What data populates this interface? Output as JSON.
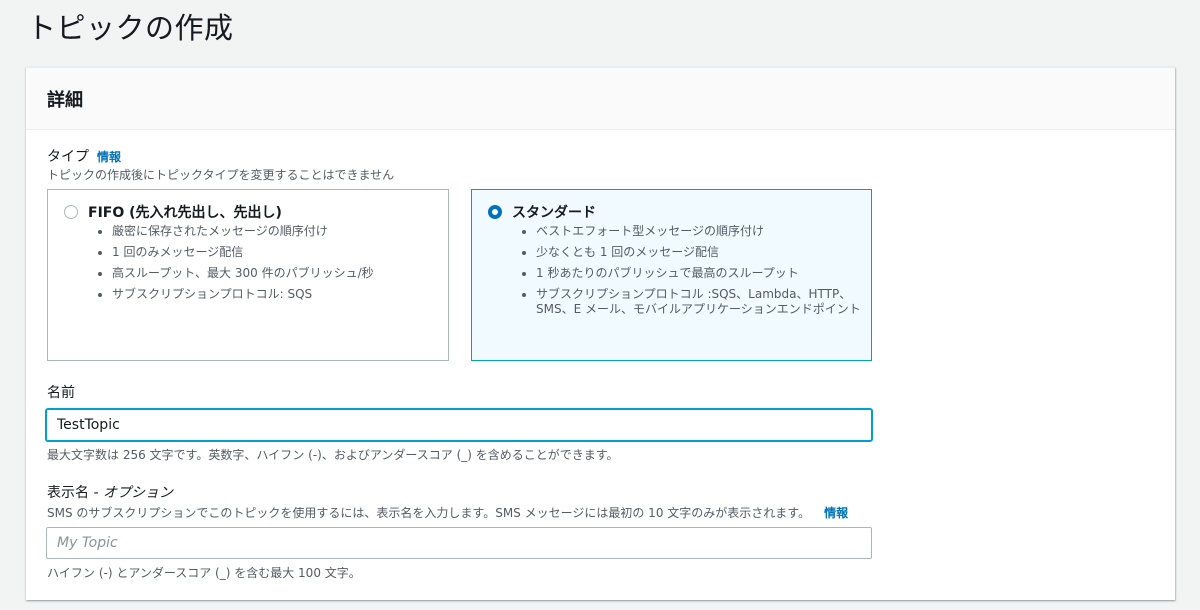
{
  "page": {
    "title": "トピックの作成"
  },
  "details": {
    "heading": "詳細",
    "type": {
      "label": "タイプ",
      "info": "情報",
      "description": "トピックの作成後にトピックタイプを変更することはできません",
      "options": [
        {
          "title": "FIFO (先入れ先出し、先出し)",
          "selected": false,
          "bullets": [
            "厳密に保存されたメッセージの順序付け",
            "1 回のみメッセージ配信",
            "高スループット、最大 300 件のパブリッシュ/秒",
            "サブスクリプションプロトコル: SQS"
          ]
        },
        {
          "title": "スタンダード",
          "selected": true,
          "bullets": [
            "ベストエフォート型メッセージの順序付け",
            "少なくとも 1 回のメッセージ配信",
            "1 秒あたりのパブリッシュで最高のスループット",
            "サブスクリプションプロトコル :SQS、Lambda、HTTP、SMS、E メール、モバイルアプリケーションエンドポイント"
          ]
        }
      ]
    },
    "name": {
      "label": "名前",
      "value": "TestTopic",
      "hint": "最大文字数は 256 文字です。英数字、ハイフン (-)、およびアンダースコア (_) を含めることができます。"
    },
    "display_name": {
      "label": "表示名",
      "label_suffix": " - オプション",
      "description": "SMS のサブスクリプションでこのトピックを使用するには、表示名を入力します。SMS メッセージには最初の 10 文字のみが表示されます。",
      "info": "情報",
      "placeholder": "My Topic",
      "hint": "ハイフン (-) とアンダースコア (_) を含む最大 100 文字。"
    }
  }
}
